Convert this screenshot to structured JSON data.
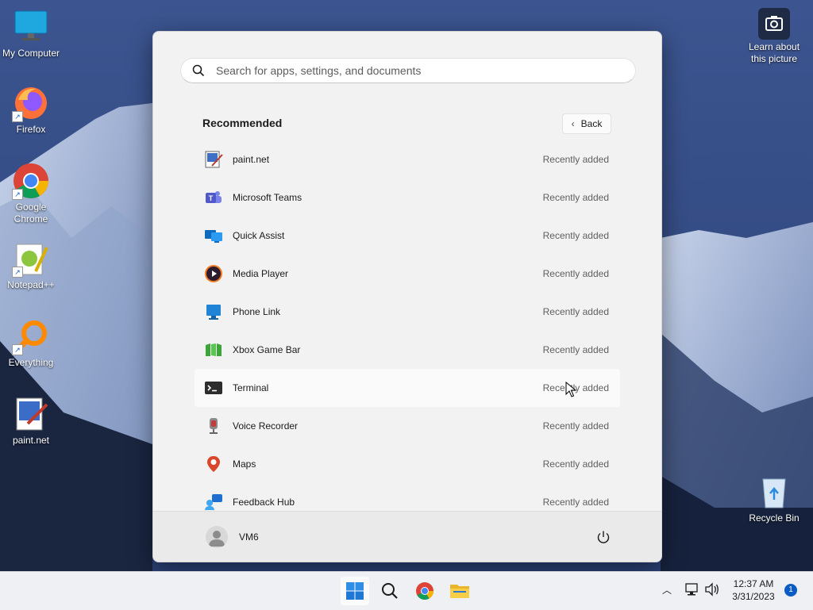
{
  "desktop": {
    "icons": [
      {
        "label": "My Computer"
      },
      {
        "label": "Firefox"
      },
      {
        "label": "Google Chrome"
      },
      {
        "label": "Notepad++"
      },
      {
        "label": "Everything"
      },
      {
        "label": "paint.net"
      }
    ],
    "learn_about": "Learn about this picture",
    "recycle_bin": "Recycle Bin"
  },
  "start_menu": {
    "search_placeholder": "Search for apps, settings, and documents",
    "recommended_title": "Recommended",
    "back_label": "Back",
    "items": [
      {
        "name": "paint.net",
        "status": "Recently added",
        "icon": "paintnet-icon"
      },
      {
        "name": "Microsoft Teams",
        "status": "Recently added",
        "icon": "teams-icon"
      },
      {
        "name": "Quick Assist",
        "status": "Recently added",
        "icon": "quick-assist-icon"
      },
      {
        "name": "Media Player",
        "status": "Recently added",
        "icon": "media-player-icon"
      },
      {
        "name": "Phone Link",
        "status": "Recently added",
        "icon": "phone-link-icon"
      },
      {
        "name": "Xbox Game Bar",
        "status": "Recently added",
        "icon": "xbox-game-bar-icon"
      },
      {
        "name": "Terminal",
        "status": "Recently added",
        "icon": "terminal-icon"
      },
      {
        "name": "Voice Recorder",
        "status": "Recently added",
        "icon": "voice-recorder-icon"
      },
      {
        "name": "Maps",
        "status": "Recently added",
        "icon": "maps-icon"
      },
      {
        "name": "Feedback Hub",
        "status": "Recently added",
        "icon": "feedback-hub-icon"
      }
    ],
    "user_name": "VM6"
  },
  "taskbar": {
    "apps": [
      "start-icon",
      "search-icon",
      "chrome-icon",
      "file-explorer-icon"
    ],
    "time": "12:37 AM",
    "date": "3/31/2023",
    "notification_count": "1"
  },
  "colors": {
    "accent": "#0a5bc4",
    "menu_bg": "#f2f2f2",
    "taskbar_bg": "#eef0f3"
  }
}
